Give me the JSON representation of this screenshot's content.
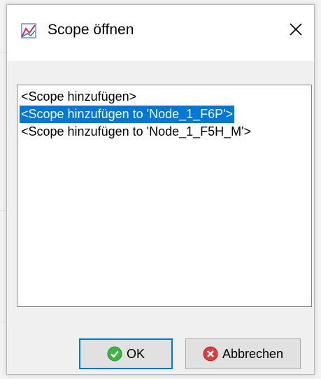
{
  "dialog": {
    "title": "Scope öffnen",
    "title_icon": "scope-chart-icon",
    "close_icon": "close-icon"
  },
  "list": {
    "items": [
      {
        "label": "<Scope hinzufügen>",
        "selected": false
      },
      {
        "label": "<Scope hinzufügen to 'Node_1_F6P'>",
        "selected": true
      },
      {
        "label": "<Scope hinzufügen to 'Node_1_F5H_M'>",
        "selected": false
      }
    ]
  },
  "buttons": {
    "ok_label": "OK",
    "ok_icon": "check-circle-icon",
    "cancel_label": "Abbrechen",
    "cancel_icon": "cancel-circle-icon"
  },
  "colors": {
    "selection": "#0078d7",
    "button_face": "#e1e1e1",
    "ok_icon_green": "#3db543",
    "cancel_icon_red": "#e23b3b"
  }
}
